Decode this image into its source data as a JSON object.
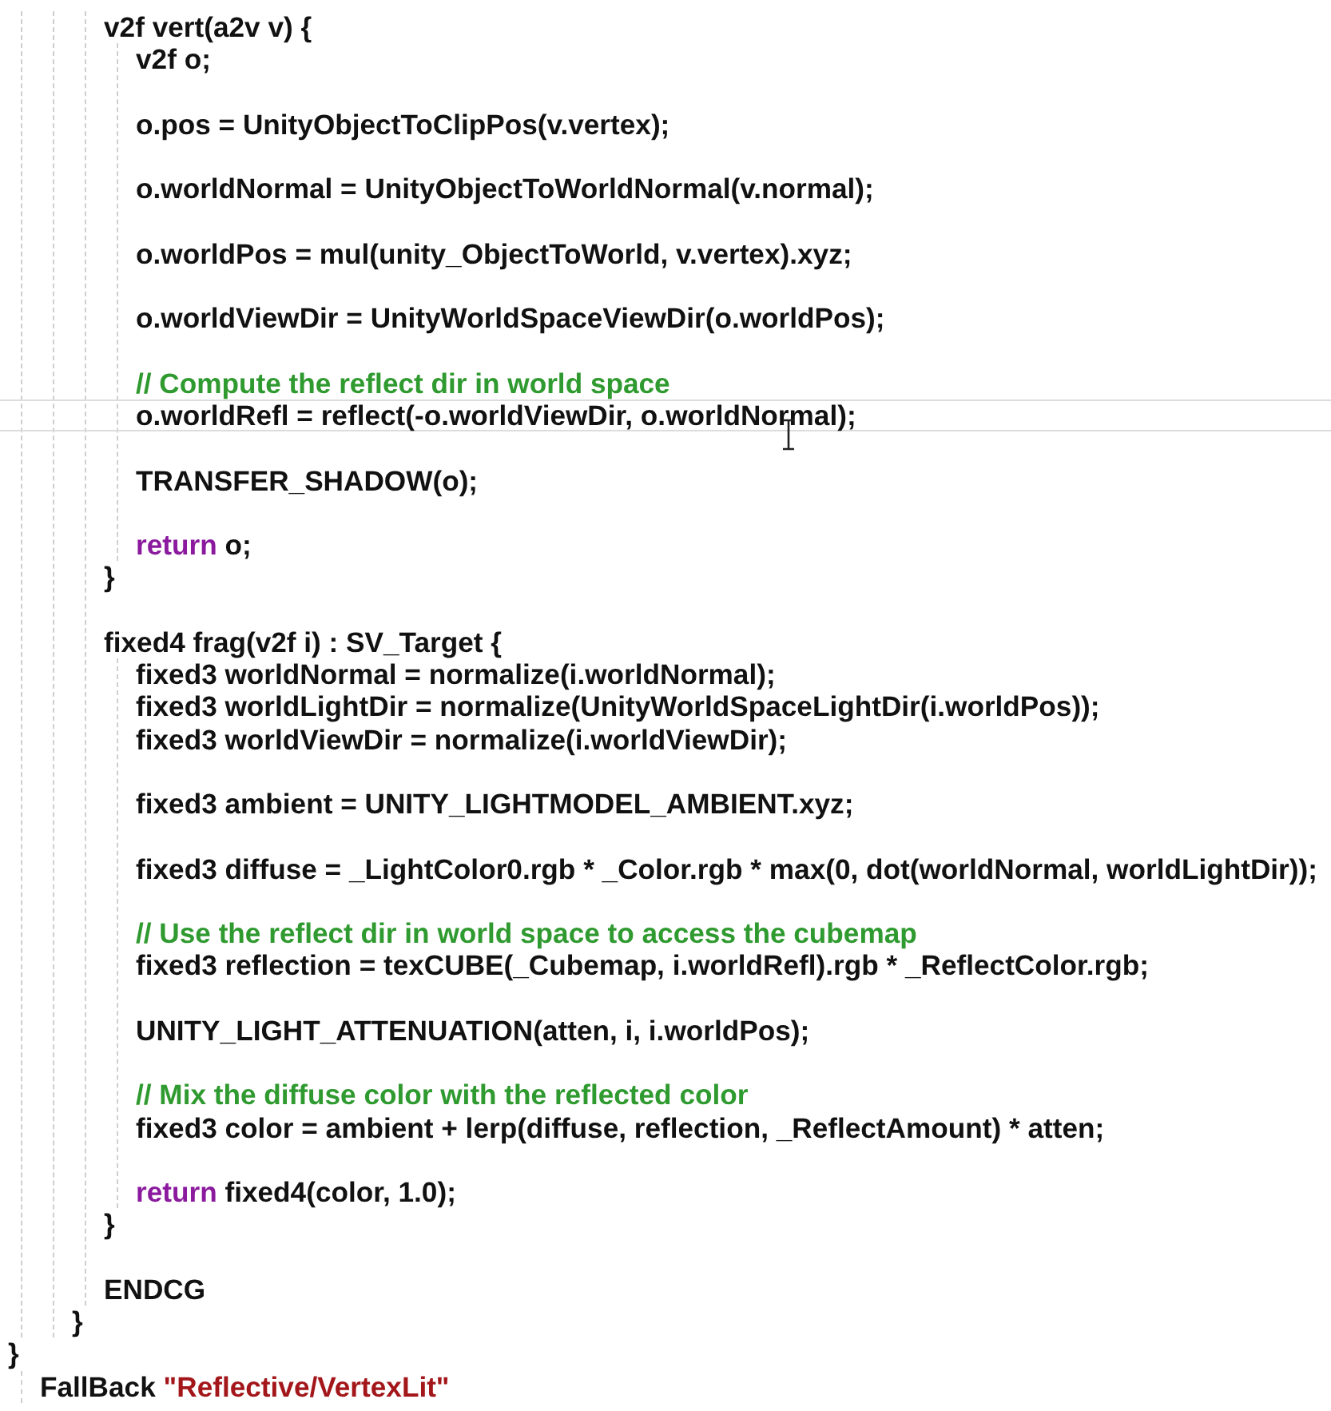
{
  "code": [
    {
      "kind": "group",
      "children": [
        {
          "kind": "group",
          "children": [
            {
              "kind": "group",
              "children": [
                {
                  "kind": "line",
                  "segments": [
                    {
                      "text": "v2f vert(a2v v) {",
                      "kind": "code"
                    }
                  ],
                  "children": [
                    {
                      "kind": "line",
                      "segments": [
                        {
                          "text": "v2f o;",
                          "kind": "code"
                        }
                      ]
                    },
                    {
                      "kind": "blank"
                    },
                    {
                      "kind": "line",
                      "segments": [
                        {
                          "text": "o.pos = UnityObjectToClipPos(v.vertex);",
                          "kind": "code"
                        }
                      ]
                    },
                    {
                      "kind": "blank"
                    },
                    {
                      "kind": "line",
                      "segments": [
                        {
                          "text": "o.worldNormal = UnityObjectToWorldNormal(v.normal);",
                          "kind": "code"
                        }
                      ]
                    },
                    {
                      "kind": "blank"
                    },
                    {
                      "kind": "line",
                      "segments": [
                        {
                          "text": "o.worldPos = mul(unity_ObjectToWorld, v.vertex).xyz;",
                          "kind": "code"
                        }
                      ]
                    },
                    {
                      "kind": "blank"
                    },
                    {
                      "kind": "line",
                      "segments": [
                        {
                          "text": "o.worldViewDir = UnityWorldSpaceViewDir(o.worldPos);",
                          "kind": "code"
                        }
                      ]
                    },
                    {
                      "kind": "blank"
                    },
                    {
                      "kind": "line",
                      "segments": [
                        {
                          "text": "// Compute the reflect dir in world space",
                          "kind": "comment"
                        }
                      ]
                    },
                    {
                      "kind": "line",
                      "current": true,
                      "segments": [
                        {
                          "text": "o.worldRefl = reflect(-o.worldViewDir, o.worldNormal);",
                          "kind": "code"
                        }
                      ]
                    },
                    {
                      "kind": "blank"
                    },
                    {
                      "kind": "line",
                      "segments": [
                        {
                          "text": "TRANSFER_SHADOW(o);",
                          "kind": "code"
                        }
                      ]
                    },
                    {
                      "kind": "blank"
                    },
                    {
                      "kind": "line",
                      "segments": [
                        {
                          "text": "return",
                          "kind": "keyword"
                        },
                        {
                          "text": " o;",
                          "kind": "code"
                        }
                      ]
                    }
                  ]
                },
                {
                  "kind": "line",
                  "segments": [
                    {
                      "text": "}",
                      "kind": "code"
                    }
                  ]
                },
                {
                  "kind": "blank"
                },
                {
                  "kind": "line",
                  "segments": [
                    {
                      "text": "fixed4 frag(v2f i) : SV_Target {",
                      "kind": "code"
                    }
                  ],
                  "children": [
                    {
                      "kind": "line",
                      "segments": [
                        {
                          "text": "fixed3 worldNormal = normalize(i.worldNormal);",
                          "kind": "code"
                        }
                      ]
                    },
                    {
                      "kind": "line",
                      "segments": [
                        {
                          "text": "fixed3 worldLightDir = normalize(UnityWorldSpaceLightDir(i.worldPos));",
                          "kind": "code"
                        }
                      ]
                    },
                    {
                      "kind": "line",
                      "segments": [
                        {
                          "text": "fixed3 worldViewDir = normalize(i.worldViewDir);",
                          "kind": "code"
                        }
                      ]
                    },
                    {
                      "kind": "blank"
                    },
                    {
                      "kind": "line",
                      "segments": [
                        {
                          "text": "fixed3 ambient = UNITY_LIGHTMODEL_AMBIENT.xyz;",
                          "kind": "code"
                        }
                      ]
                    },
                    {
                      "kind": "blank"
                    },
                    {
                      "kind": "line",
                      "segments": [
                        {
                          "text": "fixed3 diffuse = _LightColor0.rgb * _Color.rgb * max(0, dot(worldNormal, worldLightDir));",
                          "kind": "code"
                        }
                      ]
                    },
                    {
                      "kind": "blank"
                    },
                    {
                      "kind": "line",
                      "segments": [
                        {
                          "text": "// Use the reflect dir in world space to access the cubemap",
                          "kind": "comment"
                        }
                      ]
                    },
                    {
                      "kind": "line",
                      "segments": [
                        {
                          "text": "fixed3 reflection = texCUBE(_Cubemap, i.worldRefl).rgb * _ReflectColor.rgb;",
                          "kind": "code"
                        }
                      ]
                    },
                    {
                      "kind": "blank"
                    },
                    {
                      "kind": "line",
                      "segments": [
                        {
                          "text": "UNITY_LIGHT_ATTENUATION(atten, i, i.worldPos);",
                          "kind": "code"
                        }
                      ]
                    },
                    {
                      "kind": "blank"
                    },
                    {
                      "kind": "line",
                      "segments": [
                        {
                          "text": "// Mix the diffuse color with the reflected color",
                          "kind": "comment"
                        }
                      ]
                    },
                    {
                      "kind": "line",
                      "segments": [
                        {
                          "text": "fixed3 color = ambient + lerp(diffuse, reflection, _ReflectAmount) * atten;",
                          "kind": "code"
                        }
                      ]
                    },
                    {
                      "kind": "blank"
                    },
                    {
                      "kind": "line",
                      "segments": [
                        {
                          "text": "return",
                          "kind": "keyword"
                        },
                        {
                          "text": " fixed4(color, 1.0);",
                          "kind": "code"
                        }
                      ]
                    }
                  ]
                },
                {
                  "kind": "line",
                  "segments": [
                    {
                      "text": "}",
                      "kind": "code"
                    }
                  ]
                },
                {
                  "kind": "blank"
                },
                {
                  "kind": "line",
                  "segments": [
                    {
                      "text": "ENDCG",
                      "kind": "code"
                    }
                  ]
                }
              ]
            },
            {
              "kind": "line",
              "segments": [
                {
                  "text": "}",
                  "kind": "code"
                }
              ]
            }
          ]
        }
      ]
    },
    {
      "kind": "line",
      "segments": [
        {
          "text": "}",
          "kind": "code"
        }
      ]
    },
    {
      "kind": "group",
      "children": [
        {
          "kind": "line",
          "segments": [
            {
              "text": "FallBack ",
              "kind": "code"
            },
            {
              "text": "\"Reflective/VertexLit\"",
              "kind": "string"
            }
          ]
        }
      ]
    }
  ]
}
